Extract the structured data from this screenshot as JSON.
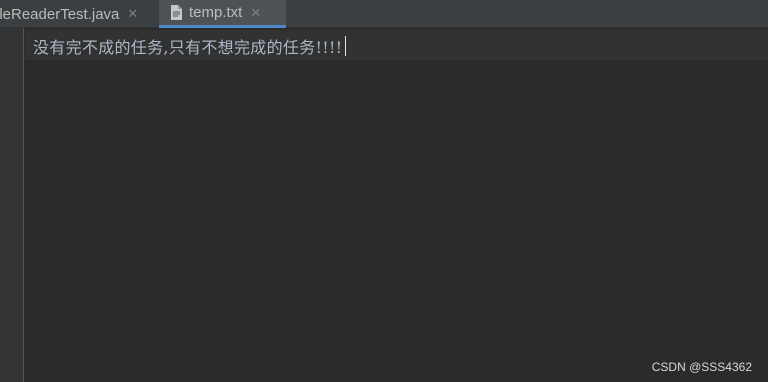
{
  "tabs": [
    {
      "label": "ileReaderTest.java",
      "active": false,
      "icon": "close-icon"
    },
    {
      "label": "temp.txt",
      "active": true,
      "icon": "text-file-icon"
    }
  ],
  "editor": {
    "lines": [
      "没有完不成的任务,只有不想完成的任务!!!!"
    ]
  },
  "watermark": "CSDN @SSS4362",
  "colors": {
    "background": "#2b2b2b",
    "tab_bar": "#3c3f41",
    "active_tab": "#4e5254",
    "active_tab_underline": "#4a88c7",
    "text": "#a9b7c6"
  }
}
